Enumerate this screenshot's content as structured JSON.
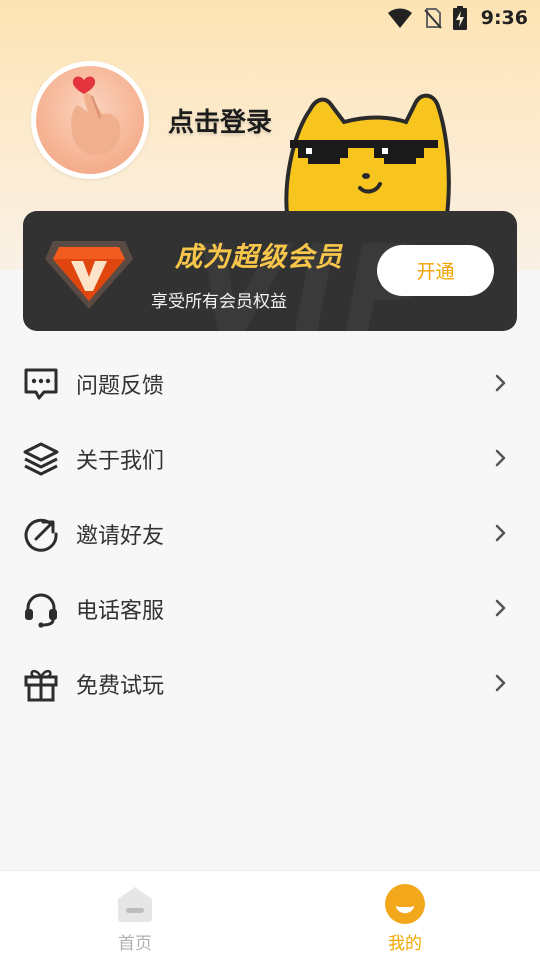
{
  "status_bar": {
    "time": "9:36"
  },
  "profile": {
    "login_text": "点击登录"
  },
  "vip": {
    "title": "成为超级会员",
    "subtitle": "享受所有会员权益",
    "open_button": "开通",
    "watermark": "VIP"
  },
  "menu": {
    "items": [
      {
        "label": "问题反馈",
        "icon": "feedback-icon"
      },
      {
        "label": "关于我们",
        "icon": "layers-icon"
      },
      {
        "label": "邀请好友",
        "icon": "share-arrow-icon"
      },
      {
        "label": "电话客服",
        "icon": "headset-icon"
      },
      {
        "label": "免费试玩",
        "icon": "gift-icon"
      }
    ]
  },
  "tabbar": {
    "tabs": [
      {
        "label": "首页",
        "active": false
      },
      {
        "label": "我的",
        "active": true
      }
    ]
  },
  "colors": {
    "accent": "#f0a800",
    "vip_gold": "#f8c64a",
    "vip_card": "#323232",
    "header_top": "#fde4b4"
  }
}
